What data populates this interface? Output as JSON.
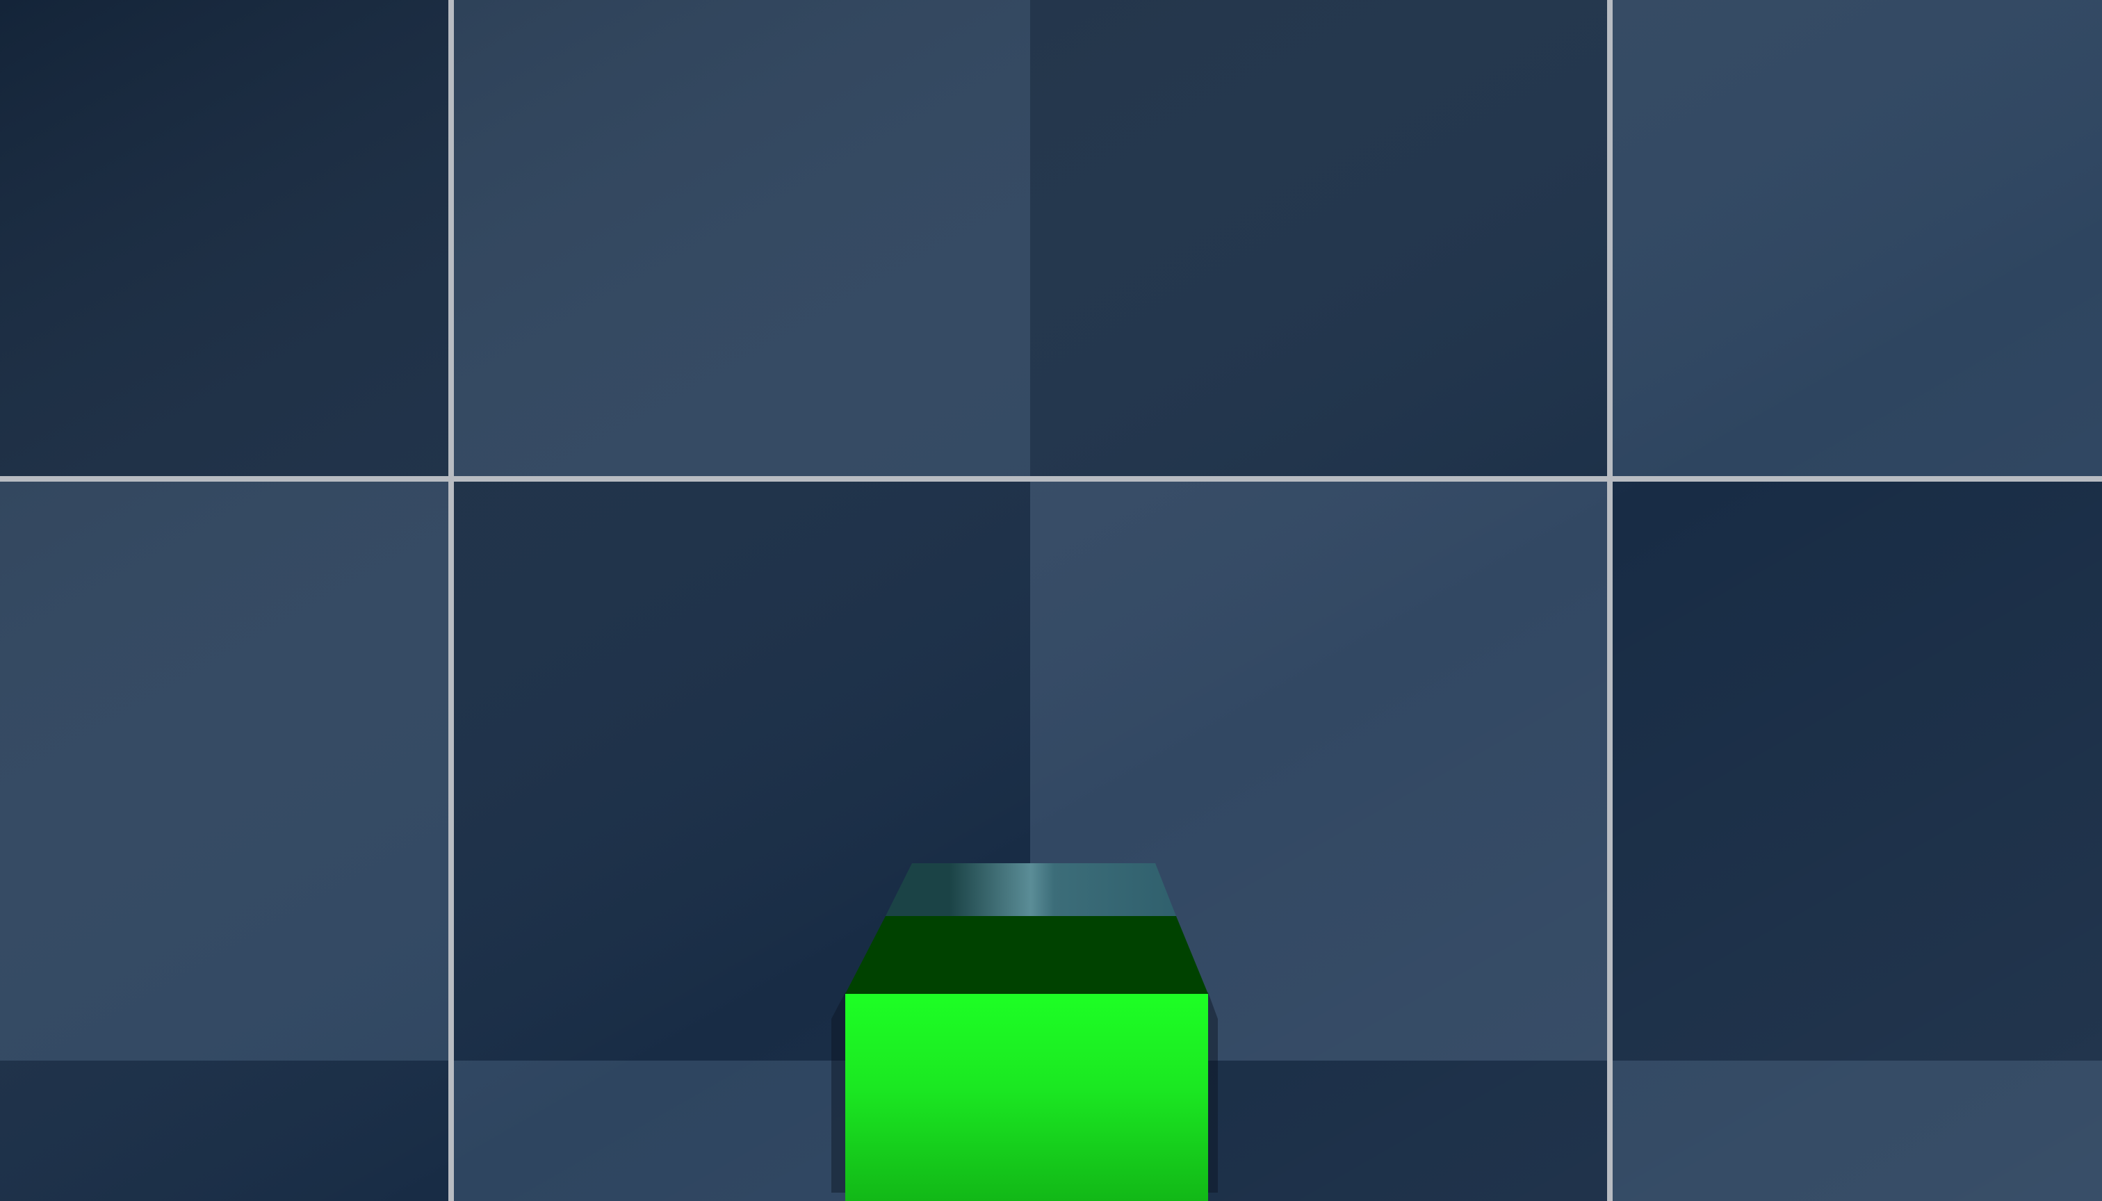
{
  "scene": {
    "kind": "3d-grid-board",
    "grid": {
      "columns": 4,
      "rows": 3
    },
    "checker_pattern": [
      [
        "dark",
        "light",
        "dark",
        "light"
      ],
      [
        "light",
        "dark",
        "light",
        "dark"
      ],
      [
        "dark",
        "light",
        "dark",
        "light"
      ]
    ],
    "player_block": {
      "column": 2,
      "row": 2,
      "shape": "cube"
    },
    "colors": {
      "tile_dark": "#182c45",
      "tile_light": "#2e4560",
      "grid_line": "#b8bcc2",
      "block_face": "#1dff24",
      "block_face_bottom": "#12b817",
      "block_side": "#004200",
      "block_top": "#1d4a4b"
    },
    "icons": [
      "green-cube-player"
    ]
  }
}
